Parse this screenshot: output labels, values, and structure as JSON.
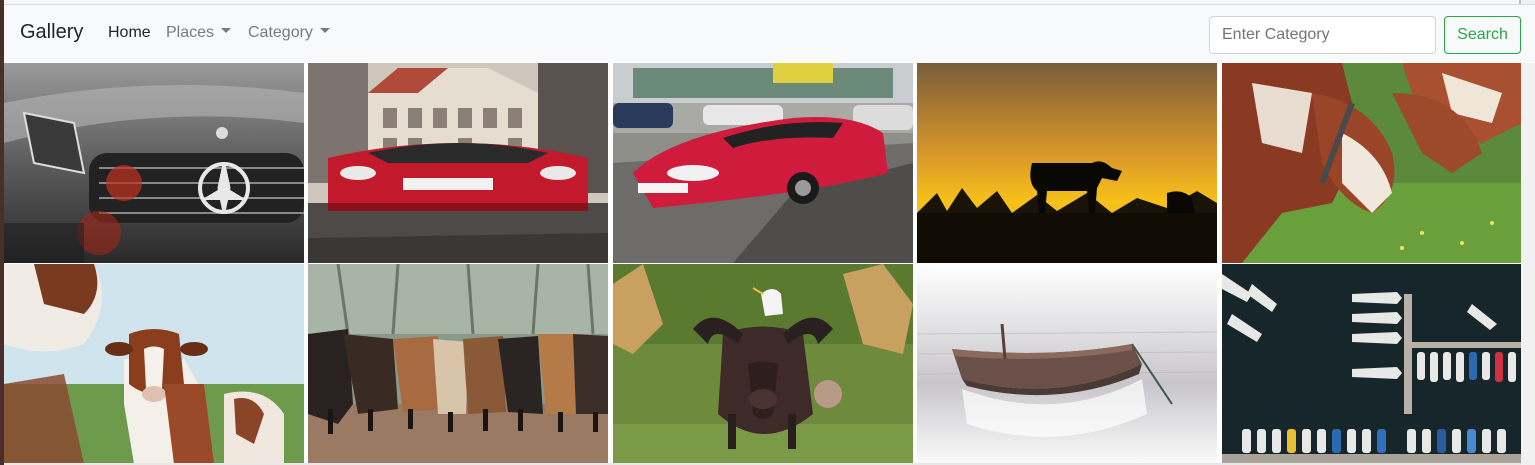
{
  "navbar": {
    "brand": "Gallery",
    "links": [
      {
        "label": "Home",
        "active": true,
        "dropdown": false
      },
      {
        "label": "Places",
        "active": false,
        "dropdown": true
      },
      {
        "label": "Category",
        "active": false,
        "dropdown": true
      }
    ],
    "search": {
      "placeholder": "Enter Category",
      "value": ""
    },
    "search_button": "Search"
  },
  "colors": {
    "navbar_bg": "#f8f9fa",
    "success_green": "#28a745"
  },
  "gallery": {
    "images": [
      {
        "subject": "silver Mercedes-Benz car front grille"
      },
      {
        "subject": "red sports car on city street"
      },
      {
        "subject": "red Mercedes convertible parked on street"
      },
      {
        "subject": "cow silhouette at sunset"
      },
      {
        "subject": "brown and white cows grazing"
      },
      {
        "subject": "brown and white calf in field"
      },
      {
        "subject": "herd of cattle walking"
      },
      {
        "subject": "buffalo with white egret on its back"
      },
      {
        "subject": "wooden boat in misty water"
      },
      {
        "subject": "aerial view of boats in marina"
      }
    ]
  }
}
